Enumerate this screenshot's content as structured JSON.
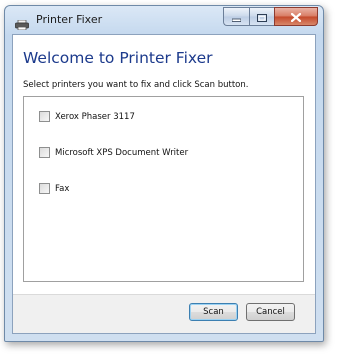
{
  "window": {
    "title": "Printer Fixer"
  },
  "main": {
    "heading": "Welcome to Printer Fixer",
    "instructions": "Select printers you want to fix and click Scan button.",
    "printers": [
      {
        "label": "Xerox Phaser 3117",
        "checked": false
      },
      {
        "label": "Microsoft XPS Document Writer",
        "checked": false
      },
      {
        "label": "Fax",
        "checked": false
      }
    ]
  },
  "buttons": {
    "scan": "Scan",
    "cancel": "Cancel"
  },
  "icons": {
    "app": "printer-icon",
    "minimize": "minimize-icon",
    "maximize": "maximize-icon",
    "close": "close-icon"
  },
  "colors": {
    "heading": "#1c3a8c",
    "close_button": "#c4482a",
    "default_button_border": "#3c7fb1"
  }
}
